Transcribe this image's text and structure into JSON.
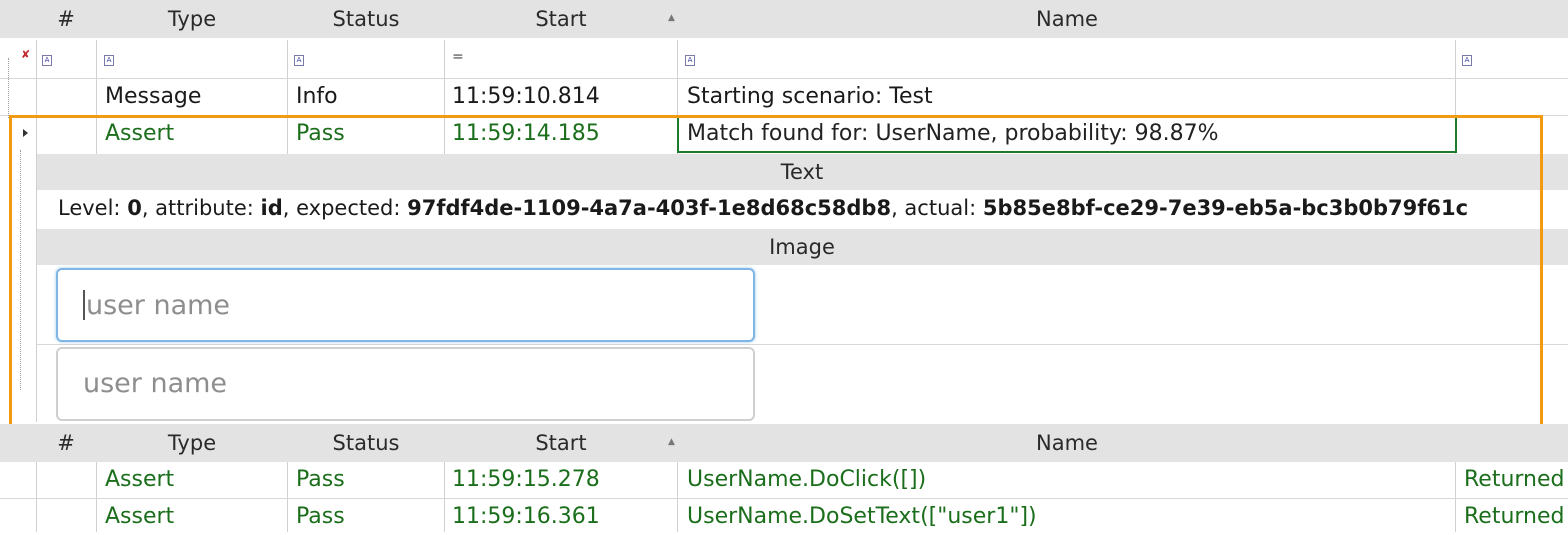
{
  "grid_header": {
    "num": "#",
    "type": "Type",
    "status": "Status",
    "start": "Start",
    "sort_indicator": "▲",
    "name": "Name"
  },
  "filter_row": {
    "pin_glyph": "✘",
    "text_filter_glyph": "A",
    "equals_glyph": "="
  },
  "rows_top": [
    {
      "num": "",
      "type": "Message",
      "status": "Info",
      "start": "11:59:10.814",
      "name": "Starting scenario: Test",
      "extra": ""
    },
    {
      "num": "",
      "type": "Assert",
      "status": "Pass",
      "start": "11:59:14.185",
      "name": "Match found for: UserName, probability: 98.87%",
      "extra": ""
    }
  ],
  "detail": {
    "text_title": "Text",
    "text_level_label": "Level: ",
    "text_level_value": "0",
    "text_attr_label": ", attribute: ",
    "text_attr_value": "id",
    "text_expected_label": ", expected: ",
    "text_expected_value": "97fdf4de-1109-4a7a-403f-1e8d68c58db8",
    "text_actual_label": ", actual: ",
    "text_actual_value": "5b85e8bf-ce29-7e39-eb5a-bc3b0b79f61c",
    "image_title": "Image",
    "image_input1_placeholder": "user name",
    "image_input2_placeholder": "user name"
  },
  "rows_bottom": [
    {
      "num": "",
      "type": "Assert",
      "status": "Pass",
      "start": "11:59:15.278",
      "name": "UserName.DoClick([])",
      "extra": "Returned"
    },
    {
      "num": "",
      "type": "Assert",
      "status": "Pass",
      "start": "11:59:16.361",
      "name": "UserName.DoSetText([\"user1\"])",
      "extra": "Returned"
    }
  ],
  "colors": {
    "pass_green": "#1b6e1b",
    "highlight_orange": "#f29a12",
    "header_gray": "#e3e3e3"
  }
}
